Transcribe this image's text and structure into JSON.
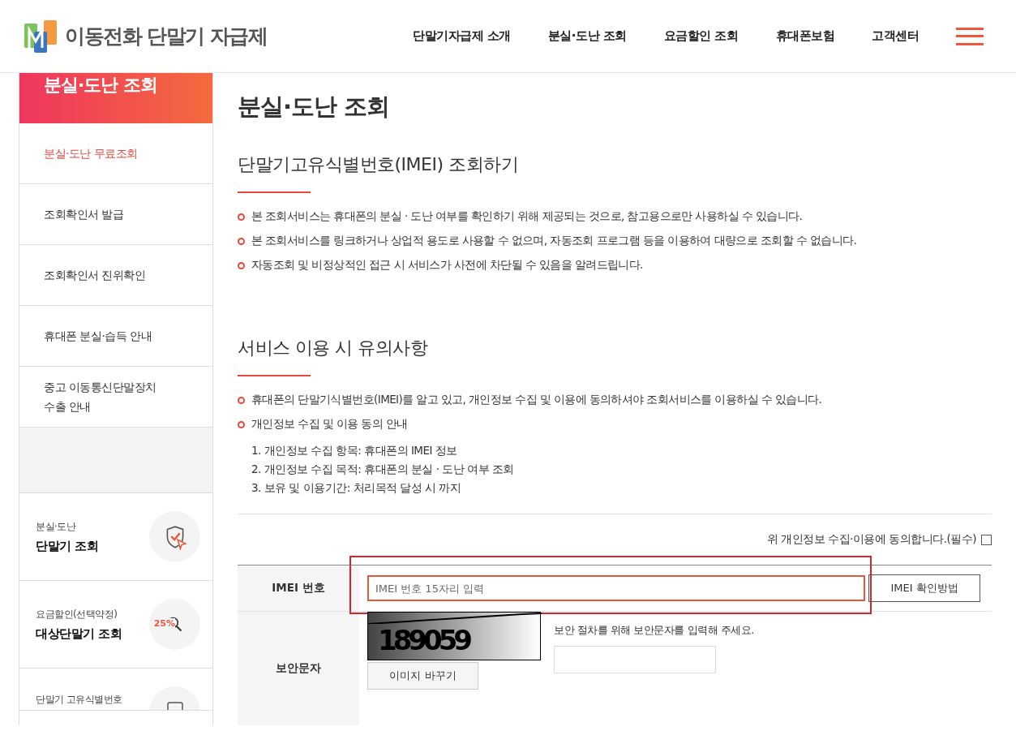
{
  "header": {
    "logo": "이동전화 단말기 자급제",
    "nav": [
      {
        "label": "단말기자급제 소개"
      },
      {
        "label": "분실·도난 조회"
      },
      {
        "label": "요금할인 조회"
      },
      {
        "label": "휴대폰보험"
      },
      {
        "label": "고객센터"
      }
    ]
  },
  "sidebar": {
    "title": "분실·도난 조회",
    "items": [
      {
        "label": "분실·도난 무료조회",
        "selected": true
      },
      {
        "label": "조회확인서 발급",
        "selected": false
      },
      {
        "label": "조회확인서 진위확인",
        "selected": false
      },
      {
        "label": "휴대폰 분실·습득 안내",
        "selected": false
      },
      {
        "label": "중고 이동통신단말장치\n수출 안내",
        "selected": false
      }
    ],
    "quick_links": [
      {
        "kind": "shield",
        "sub": "분실·도난",
        "main": "단말기 조회"
      },
      {
        "kind": "discount",
        "sub": "요금할인(선택약정)",
        "main": "대상단말기 조회",
        "icon_text": "25%"
      },
      {
        "kind": "imei",
        "sub": "단말기 고유식별번호"
      }
    ]
  },
  "main": {
    "title": "분실·도난 조회",
    "sections": [
      {
        "heading": "단말기고유식별번호(IMEI) 조회하기",
        "bullets": [
          "본 조회서비스는 휴대폰의 분실 · 도난 여부를 확인하기 위해 제공되는 것으로, 참고용으로만 사용하실 수 있습니다.",
          "본 조회서비스를 링크하거나 상업적 용도로 사용할 수 없으며, 자동조회 프로그램 등을 이용하여 대량으로 조회할 수 없습니다.",
          "자동조회 및 비정상적인 접근 시 서비스가 사전에 차단될 수 있음을 알려드립니다."
        ]
      },
      {
        "heading": "서비스 이용 시 유의사항",
        "bullets": [
          "휴대폰의 단말기식별번호(IMEI)를 알고 있고, 개인정보 수집 및 이용에 동의하셔야 조회서비스를 이용하실 수 있습니다.",
          "개인정보 수집 및 이용 동의 안내"
        ],
        "numbered": [
          "1. 개인정보 수집 항목: 휴대폰의 IMEI 정보",
          "2. 개인정보 수집 목적: 휴대폰의 분실 · 도난 여부 조회",
          "3. 보유 및 이용기간: 처리목적 달성 시 까지"
        ]
      }
    ],
    "consent": {
      "label": "위 개인정보 수집·이용에 동의합니다.(필수)",
      "checked": false
    },
    "form": {
      "imei_label": "IMEI 번호",
      "imei_placeholder": "IMEI 번호 15자리 입력",
      "imei_help_button": "IMEI 확인방법",
      "highlight": true,
      "captcha_label": "보안문자",
      "captcha_text": "189059",
      "captcha_refresh": "이미지 바꾸기",
      "captcha_hint": "보안 절차를 위해 보안문자를 입력해 주세요."
    }
  }
}
